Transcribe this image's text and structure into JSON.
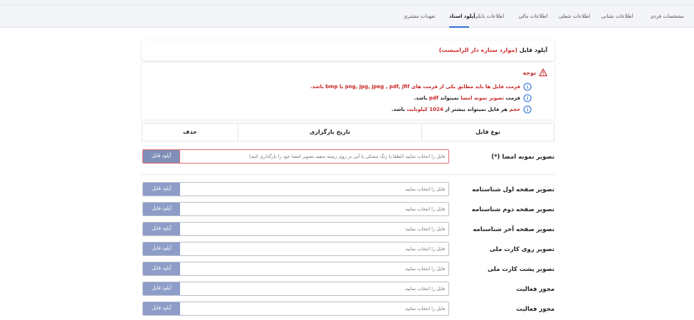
{
  "tabs": [
    {
      "label": "مشخصات فردی",
      "active": false
    },
    {
      "label": "اطلاعات نشانی",
      "active": false
    },
    {
      "label": "اطلاعات شغلی",
      "active": false
    },
    {
      "label": "اطلاعات مالی",
      "active": false
    },
    {
      "label": "اطلاعات بانکی",
      "active": false
    },
    {
      "label": "آپلود اسناد",
      "active": true
    },
    {
      "label": "تعهدات مشتری",
      "active": false
    }
  ],
  "upload_card": {
    "title": "آپلود فایل",
    "required_note": "(موارد ستاره دار الزامیست)"
  },
  "notice": {
    "heading": "توجه",
    "line1": "فرمت فایل ها باید مطابق یکی از فرمت های png, jpg, jpeg , pdf, jfif یا bmp باشد.",
    "line2_prefix": "فرمت",
    "line2_red": "تصویر نمونه امضا",
    "line2_mid": "نمیتواند",
    "line2_red2": "pdf",
    "line2_suffix": "باشد.",
    "line3_red": "حجم",
    "line3_mid": "هر فایل نمیتواند بیشتر از",
    "line3_red2": "1024 کیلوبایت",
    "line3_suffix": "باشد."
  },
  "table_headers": {
    "file_type": "نوع فایل",
    "upload_date": "تاریخ بارگزاری",
    "delete": "حذف"
  },
  "upload_button_label": "آپلود فایل",
  "rows": [
    {
      "label": "تصویر نمونه امضا (*)",
      "placeholder": "فایل را انتخاب نمایید (لطفا با رنگ مشکی یا آبی بر روی زمینه سفید تصویر امضا خود را بارگذاری کنید)",
      "error": true
    },
    {
      "label": "تصویر صفحه اول شناسنامه",
      "placeholder": "فایل را انتخاب نمایید",
      "error": false
    },
    {
      "label": "تصویر صفحه دوم شناسنامه",
      "placeholder": "فایل را انتخاب نمایید",
      "error": false
    },
    {
      "label": "تصویر صفحه آخر شناسنامه",
      "placeholder": "فایل را انتخاب نمایید",
      "error": false
    },
    {
      "label": "تصویر روی کارت ملی",
      "placeholder": "فایل را انتخاب نمایید",
      "error": false
    },
    {
      "label": "تصویر پشت کارت ملی",
      "placeholder": "فایل را انتخاب نمایید",
      "error": false
    },
    {
      "label": "مجوز فعالیت",
      "placeholder": "فایل را انتخاب نمایید",
      "error": false
    },
    {
      "label": "مجوز فعالیت",
      "placeholder": "فایل را انتخاب نمایید",
      "error": false
    }
  ],
  "colors": {
    "accent": "#2f6fd6",
    "error": "#c62828",
    "upload_button": "#8e9dc8"
  }
}
